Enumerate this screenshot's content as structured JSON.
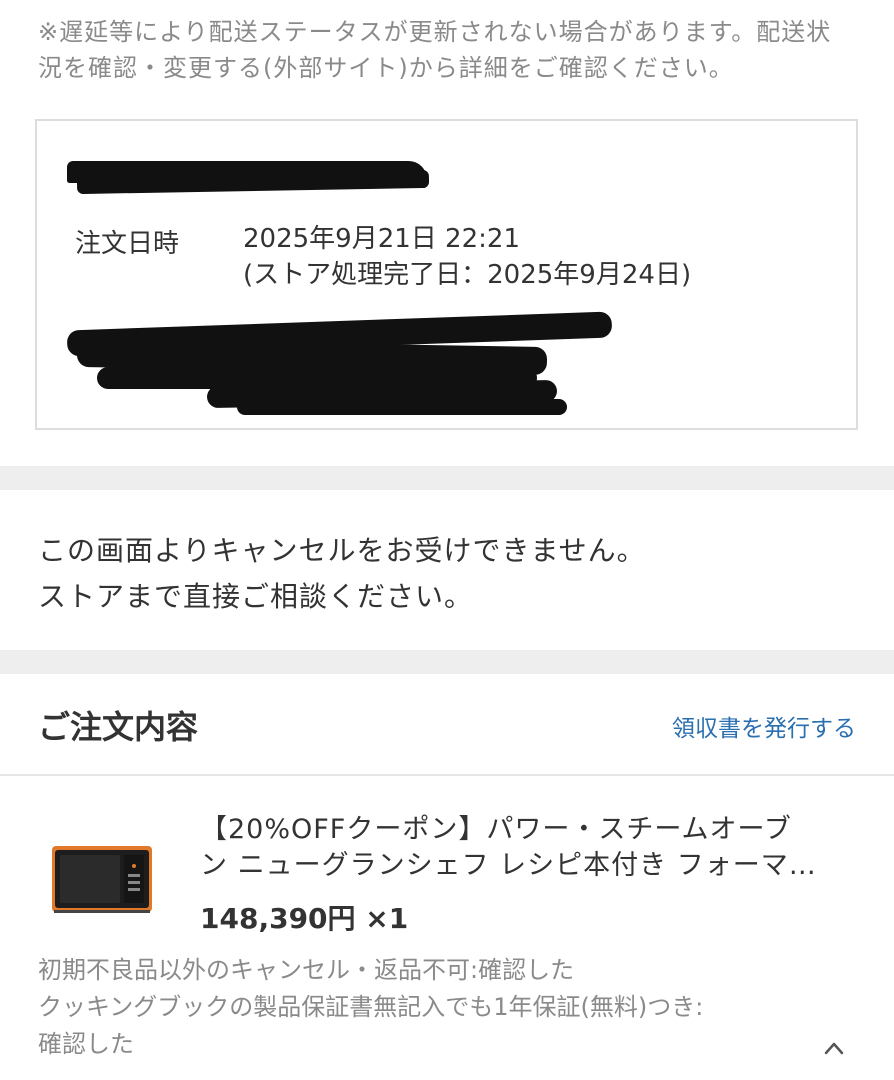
{
  "notice": {
    "line1": "※遅延等により配送ステータスが更新されない場合があります。配送状",
    "line2": "況を確認・変更する(外部サイト)から詳細をご確認ください。"
  },
  "order_info": {
    "date_label": "注文日時",
    "date_value": "2025年9月21日 22:21",
    "store_processed": "(ストア処理完了日：2025年9月24日)"
  },
  "cancel_message": {
    "line1": "この画面よりキャンセルをお受けできません。",
    "line2": "ストアまで直接ご相談ください。"
  },
  "order_section": {
    "title": "ご注文内容",
    "receipt_link": "領収書を発行する"
  },
  "item": {
    "title_line1": "【20%OFFクーポン】パワー・スチームオーブ",
    "title_line2": "ン ニューグランシェフ レシピ本付き フォーマ…",
    "price": "148,390円 ×1",
    "notes": [
      "初期不良品以外のキャンセル・返品不可:確認した",
      "クッキングブックの製品保証書無記入でも1年保証(無料)つき:",
      "確認した"
    ]
  },
  "colors": {
    "link": "#2a6fb0",
    "muted_text": "#8a8a8a",
    "band": "#eeeeee"
  }
}
